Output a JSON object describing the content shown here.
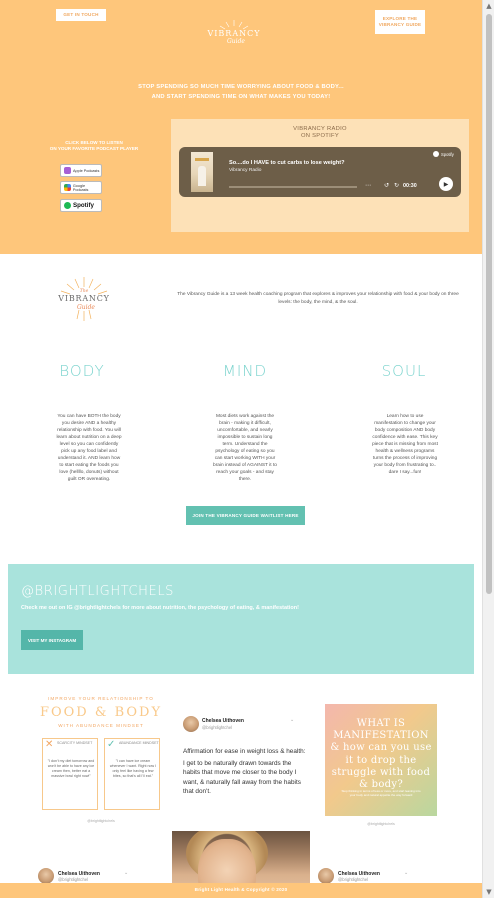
{
  "colors": {
    "peach": "#fec67b",
    "teal_light": "#a9e3dc",
    "teal": "#63c1b1",
    "mint_text": "#79d3cd"
  },
  "hero": {
    "get_in_touch": "GET IN TOUCH",
    "explore": "EXPLORE THE VIBRANCY GUIDE",
    "logo_text": "VIBRANCY",
    "logo_script": "Guide",
    "tagline_line1": "STOP SPENDING SO MUCH TIME WORRYING ABOUT FOOD & BODY...",
    "tagline_line2": "AND START SPENDING TIME ON WHAT MAKES YOU TODAY!",
    "listen_line1": "CLICK BELOW TO LISTEN",
    "listen_line2": "ON YOUR FAVORITE PODCAST PLAYER",
    "badges": [
      {
        "label": "Apple Podcasts",
        "icon": "apple-podcasts-icon"
      },
      {
        "label": "Google Podcasts",
        "icon": "google-podcasts-icon"
      },
      {
        "label": "Spotify",
        "icon": "spotify-icon"
      }
    ]
  },
  "podcast": {
    "panel_title_line1": "VIBRANCY RADIO",
    "panel_title_line2": "ON SPOTIFY",
    "episode_title": "So....do I HAVE to cut carbs to lose weight?",
    "show_name": "Vibrancy Radio",
    "spotify_label": "Spotify",
    "time": "00:30",
    "progress": 0.0
  },
  "about": {
    "logo_prefix": "The",
    "logo_text": "VIBRANCY",
    "logo_script": "Guide",
    "description": "The Vibrancy Guide is a 13 week health coaching program that explores & improves your relationship with food & your body on three levels: the body, the mind, & the soul.",
    "pillars": [
      {
        "title": "BODY",
        "text": "You can have BOTH the body you desire AND a healthy relationship with food. You will learn about nutrition on a deep level so you can confidently pick up any food label and understand it. AND learn how to start eating the foods you love (hellllo, donuts) without guilt OR overeating."
      },
      {
        "title": "MIND",
        "text": "Most diets work against the brain - making it difficult, uncomfortable, and nearly impossible to sustain long term. Understand the psychology of eating so you can start working WITH your brain instead of AGAINST it to reach your goals - and stay there."
      },
      {
        "title": "SOUL",
        "text": "Learn how to use manifestation to change your body composition AND body confidence with ease. This key piece that is missing from most health & wellness programs turns the process of improving your body from frustrating to.. dare I say...fun!"
      }
    ],
    "waitlist_button": "JOIN THE VIBRANCY GUIDE WAITLIST HERE"
  },
  "instagram": {
    "handle": "@BRIGHTLIGHTCHELS",
    "subtitle": "Check me out on IG @brightlightchels for more about nutrition, the psychology of eating, & manifestation!",
    "button": "VISIT MY INSTAGRAM"
  },
  "grid": {
    "card1": {
      "title_a": "IMPROVE YOUR RELATIONSHIP TO",
      "title_b": "FOOD & BODY",
      "title_c": "WITH ABUNDANCE MINDSET",
      "left_label": "SCARCITY MINDSET",
      "left_text": "\"I don't my diet tomorrow and won't be able to have any ice cream then, better eat a massive bowl right now!\"",
      "right_label": "ABUNDANCE MINDSET",
      "right_text": "\"I can have ice cream whenever I want. Right now I only feel like having a few bites, so that's all I'll eat.\"",
      "handle": "@brightlightchels"
    },
    "tweet": {
      "name": "Chelsea Uithoven",
      "handle": "@brightlightchel",
      "more": "⌄",
      "line1": "Affirmation for ease in weight loss & health:",
      "line2": "I get to be naturally drawn towards the habits that move me closer to the body I want, & naturally fall away from the habits that don't."
    },
    "card3": {
      "title": "WHAT IS MANIFESTATION & how can you use it to drop the struggle with food & body?",
      "note": "Stop thinking in terms of less or more, and start leaning into your body and natural appetite the way forward",
      "handle": "@brightlightchels"
    },
    "tweet_small_left": {
      "name": "Chelsea Uithoven",
      "handle": "@brightlightchel",
      "more": "⌄"
    },
    "tweet_small_right": {
      "name": "Chelsea Uithoven",
      "handle": "@brightlightchel",
      "more": "⌄"
    }
  },
  "footer": {
    "text": "Bright Light Health & Copyright © 2020"
  }
}
